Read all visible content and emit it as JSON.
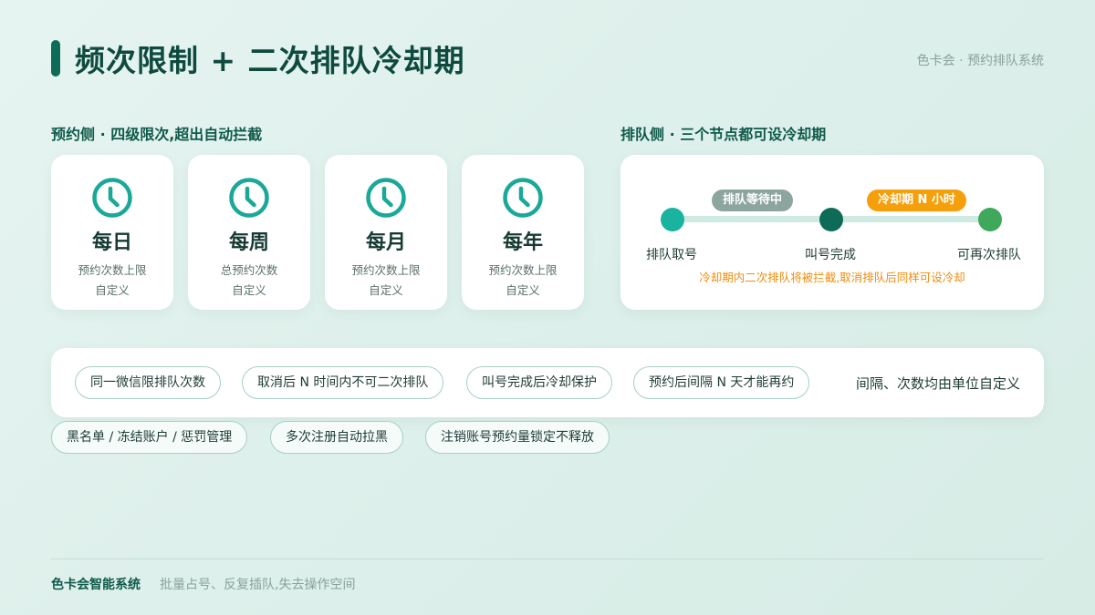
{
  "header": {
    "title": "频次限制 + 二次排队冷却期",
    "brand": "色卡会 · 预约排队系统"
  },
  "booking": {
    "label": "预约侧 · 四级限次,超出自动拦截",
    "cards": [
      {
        "icon": "clock-icon",
        "title": "每日",
        "line1": "预约次数上限",
        "line2": "自定义"
      },
      {
        "icon": "clock-icon",
        "title": "每周",
        "line1": "总预约次数",
        "line2": "自定义"
      },
      {
        "icon": "clock-icon",
        "title": "每月",
        "line1": "预约次数上限",
        "line2": "自定义"
      },
      {
        "icon": "clock-icon",
        "title": "每年",
        "line1": "预约次数上限",
        "line2": "自定义"
      }
    ]
  },
  "queue": {
    "label": "排队侧 · 三个节点都可设冷却期",
    "tag_wait": "排队等待中",
    "tag_cooldown": "冷却期 N 小时",
    "nodes": [
      "排队取号",
      "叫号完成",
      "可再次排队"
    ],
    "note": "冷却期内二次排队将被拦截,取消排队后同样可设冷却"
  },
  "features": {
    "chips": [
      "同一微信限排队次数",
      "取消后 N 时间内不可二次排队",
      "叫号完成后冷却保护",
      "预约后间隔 N 天才能再约"
    ],
    "note": "间隔、次数均由单位自定义",
    "chips_row2": [
      "黑名单 / 冻结账户 / 惩罚管理",
      "多次注册自动拉黑",
      "注销账号预约量锁定不释放"
    ]
  },
  "footer": {
    "brand": "色卡会智能系统",
    "text": "批量占号、反复插队,失去操作空间"
  },
  "colors": {
    "primary": "#0e6b57",
    "teal": "#1ab3a0",
    "green": "#3fa85b",
    "orange": "#f59f0b",
    "grey": "#8da59f"
  }
}
